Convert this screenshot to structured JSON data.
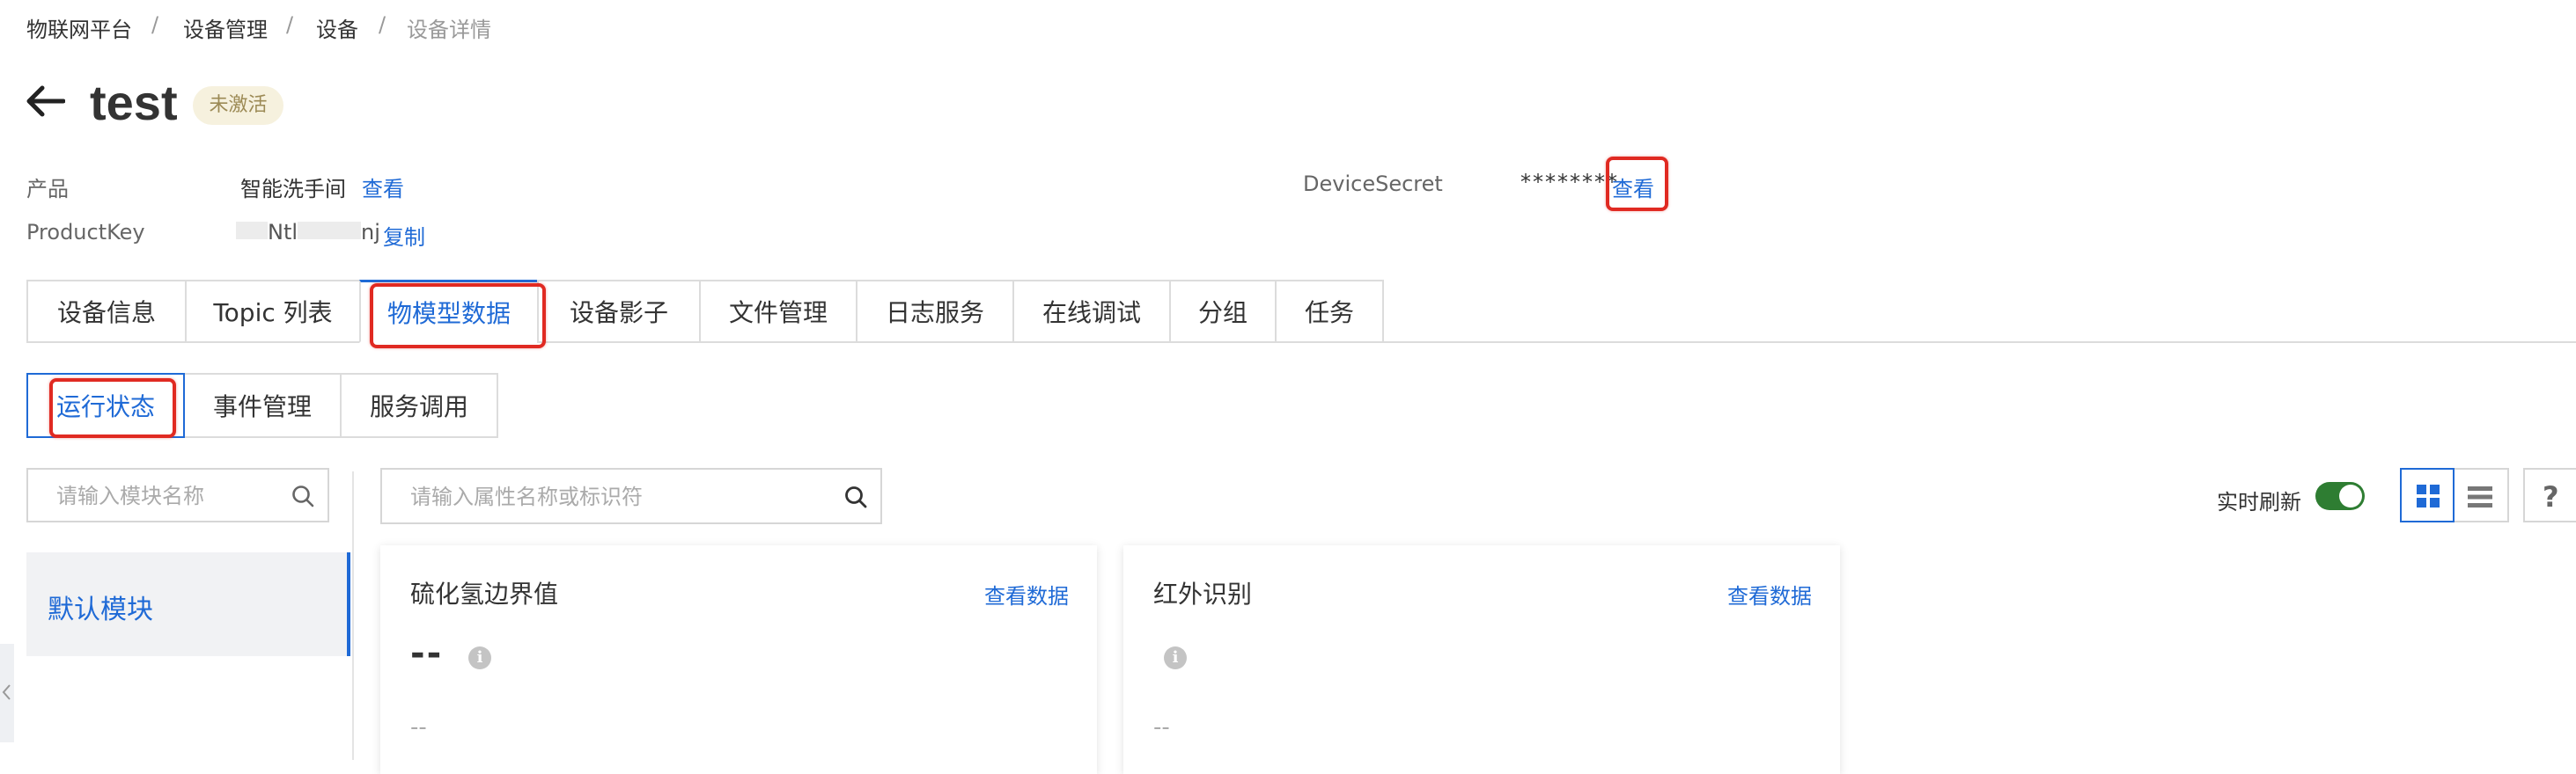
{
  "breadcrumb": [
    "物联网平台",
    "设备管理",
    "设备",
    "设备详情"
  ],
  "breadcrumb_sep": "/",
  "device": {
    "name": "test",
    "status": "未激活"
  },
  "info": {
    "product_label": "产品",
    "product_value": "智能洗手间",
    "product_link": "查看",
    "productkey_label": "ProductKey",
    "productkey_value": "Ntl",
    "productkey_value_tail": "nj",
    "productkey_link": "复制",
    "secret_label": "DeviceSecret",
    "secret_value": "********",
    "secret_link": "查看"
  },
  "tabs": [
    {
      "label": "设备信息"
    },
    {
      "label": "Topic 列表"
    },
    {
      "label": "物模型数据"
    },
    {
      "label": "设备影子"
    },
    {
      "label": "文件管理"
    },
    {
      "label": "日志服务"
    },
    {
      "label": "在线调试"
    },
    {
      "label": "分组"
    },
    {
      "label": "任务"
    }
  ],
  "active_tab": "物模型数据",
  "subtabs": [
    {
      "label": "运行状态"
    },
    {
      "label": "事件管理"
    },
    {
      "label": "服务调用"
    }
  ],
  "active_subtab": "运行状态",
  "module_search": {
    "placeholder": "请输入模块名称"
  },
  "property_search": {
    "placeholder": "请输入属性名称或标识符"
  },
  "modules": [
    {
      "label": "默认模块"
    }
  ],
  "realtime": {
    "label": "实时刷新",
    "enabled": true
  },
  "help_icon": "question-icon",
  "cards": [
    {
      "title": "硫化氢边界值",
      "link": "查看数据",
      "value": "--",
      "sub": "--"
    },
    {
      "title": "红外识别",
      "link": "查看数据",
      "value": "",
      "sub": "--"
    }
  ],
  "colors": {
    "accent": "#1f6ad6",
    "highlight": "#e02a22",
    "toggle_on": "#2e7d32",
    "badge_bg": "#f6f1de"
  }
}
